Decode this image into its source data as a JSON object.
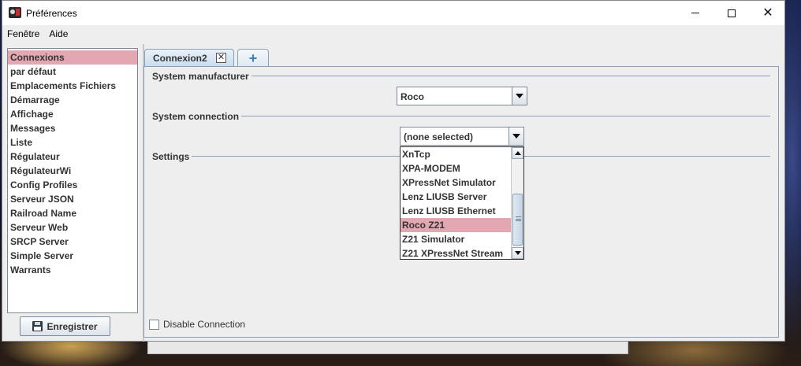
{
  "window": {
    "title": "Préférences"
  },
  "menubar": {
    "items": [
      "Fenêtre",
      "Aide"
    ]
  },
  "sidebar": {
    "items": [
      {
        "label": "Connexions",
        "selected": true
      },
      {
        "label": "par défaut"
      },
      {
        "label": "Emplacements Fichiers"
      },
      {
        "label": "Démarrage"
      },
      {
        "label": "Affichage"
      },
      {
        "label": "Messages"
      },
      {
        "label": "Liste"
      },
      {
        "label": "Régulateur"
      },
      {
        "label": "RégulateurWi"
      },
      {
        "label": "Config Profiles"
      },
      {
        "label": "Serveur JSON"
      },
      {
        "label": "Railroad Name"
      },
      {
        "label": "Serveur Web"
      },
      {
        "label": "SRCP Server"
      },
      {
        "label": "Simple Server"
      },
      {
        "label": "Warrants"
      }
    ],
    "save_label": "Enregistrer"
  },
  "tabs": {
    "active_label": "Connexion2"
  },
  "connection": {
    "manufacturer_title": "System manufacturer",
    "manufacturer_value": "Roco",
    "connection_title": "System connection",
    "connection_value": "(none selected)",
    "settings_title": "Settings",
    "disable_label": "Disable Connection"
  },
  "dropdown": {
    "items": [
      {
        "label": "XnTcp"
      },
      {
        "label": "XPA-MODEM"
      },
      {
        "label": "XPressNet Simulator"
      },
      {
        "label": "Lenz LIUSB Server"
      },
      {
        "label": "Lenz LIUSB Ethernet"
      },
      {
        "label": "Roco Z21",
        "selected": true
      },
      {
        "label": "Z21 Simulator"
      },
      {
        "label": "Z21 XPressNet Stream"
      }
    ]
  },
  "colors": {
    "selection": "#e3a7b1",
    "border": "#8aa0b6",
    "window_bg": "#eeeeee"
  }
}
